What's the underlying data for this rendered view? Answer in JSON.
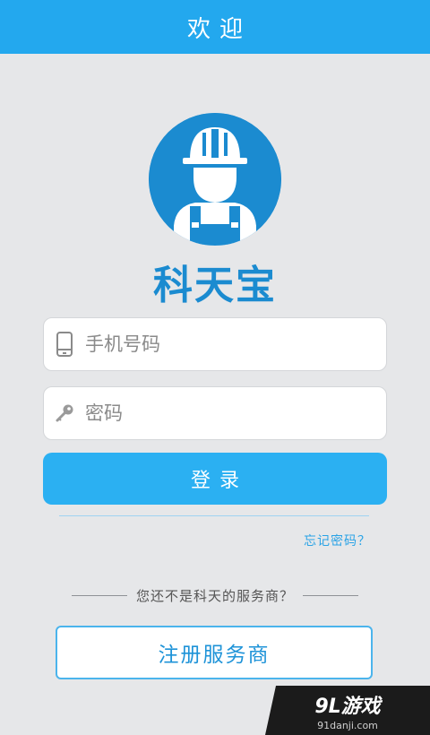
{
  "header": {
    "title": "欢迎"
  },
  "brand": {
    "name": "科天宝"
  },
  "form": {
    "phone": {
      "placeholder": "手机号码",
      "value": ""
    },
    "password": {
      "placeholder": "密码",
      "value": ""
    },
    "login_label": "登录",
    "forgot_label": "忘记密码？"
  },
  "register": {
    "prompt": "您还不是科天的服务商？",
    "button_label": "注册服务商"
  },
  "watermark": {
    "main": "9L游戏",
    "sub": "91danji.com"
  },
  "colors": {
    "primary": "#23a8ee",
    "brand": "#1b8bd0",
    "background": "#e6e7e9"
  },
  "icons": {
    "phone": "phone-icon",
    "password": "key-icon",
    "logo": "worker-helmet-logo"
  }
}
